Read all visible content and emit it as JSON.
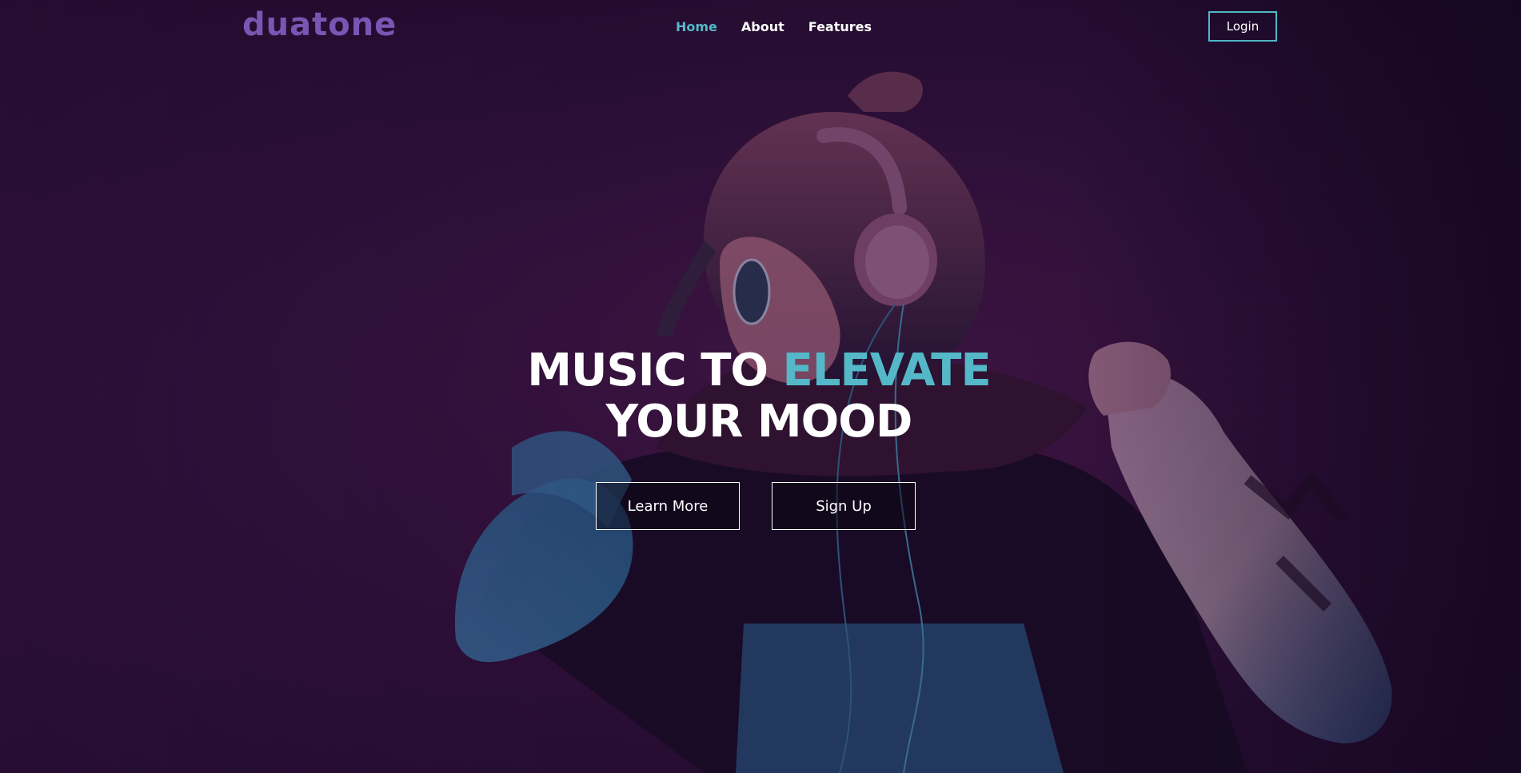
{
  "brand": {
    "logo_text": "duatone"
  },
  "nav": {
    "links": [
      {
        "label": "Home",
        "active": true
      },
      {
        "label": "About",
        "active": false
      },
      {
        "label": "Features",
        "active": false
      }
    ],
    "login_label": "Login"
  },
  "hero": {
    "title_part1": "MUSIC TO ",
    "title_accent": "ELEVATE",
    "title_line2": "YOUR MOOD",
    "buttons": {
      "learn_more": "Learn More",
      "sign_up": "Sign Up"
    }
  },
  "colors": {
    "accent": "#55b8c8",
    "logo": "#7a55b3",
    "background": "#3a1544"
  }
}
